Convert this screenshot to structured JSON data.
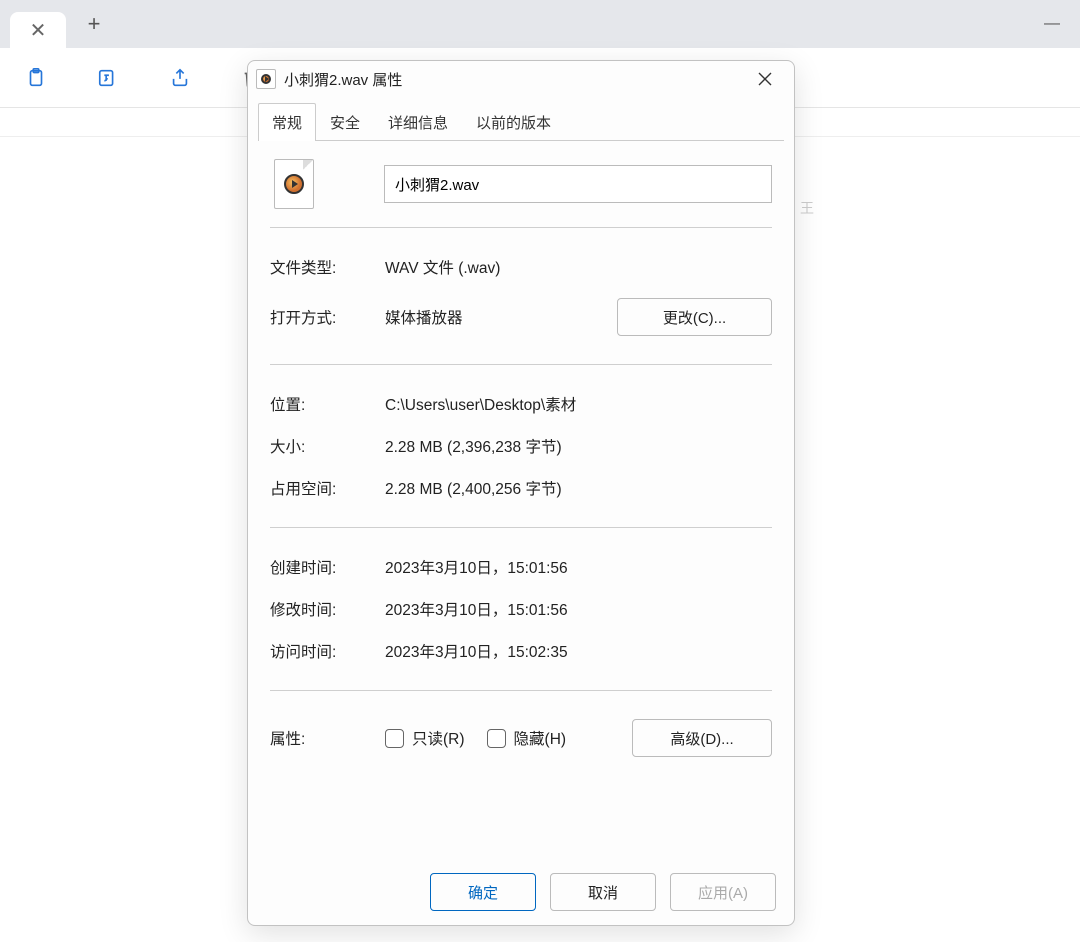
{
  "bg": {
    "stub": "王"
  },
  "dialog": {
    "title": "小刺猬2.wav 属性",
    "tabs": {
      "general": "常规",
      "security": "安全",
      "details": "详细信息",
      "previous": "以前的版本"
    },
    "filename": "小刺猬2.wav",
    "labels": {
      "filetype": "文件类型:",
      "openwith": "打开方式:",
      "location": "位置:",
      "size": "大小:",
      "sizeOnDisk": "占用空间:",
      "created": "创建时间:",
      "modified": "修改时间:",
      "accessed": "访问时间:",
      "attributes": "属性:"
    },
    "values": {
      "filetype": "WAV 文件 (.wav)",
      "openwith": "媒体播放器",
      "location": "C:\\Users\\user\\Desktop\\素材",
      "size": "2.28 MB (2,396,238 字节)",
      "sizeOnDisk": "2.28 MB (2,400,256 字节)",
      "created": "2023年3月10日，15:01:56",
      "modified": "2023年3月10日，15:01:56",
      "accessed": "2023年3月10日，15:02:35"
    },
    "buttons": {
      "change": "更改(C)...",
      "advanced": "高级(D)...",
      "ok": "确定",
      "cancel": "取消",
      "apply": "应用(A)"
    },
    "checkboxes": {
      "readonly": "只读(R)",
      "hidden": "隐藏(H)"
    }
  }
}
